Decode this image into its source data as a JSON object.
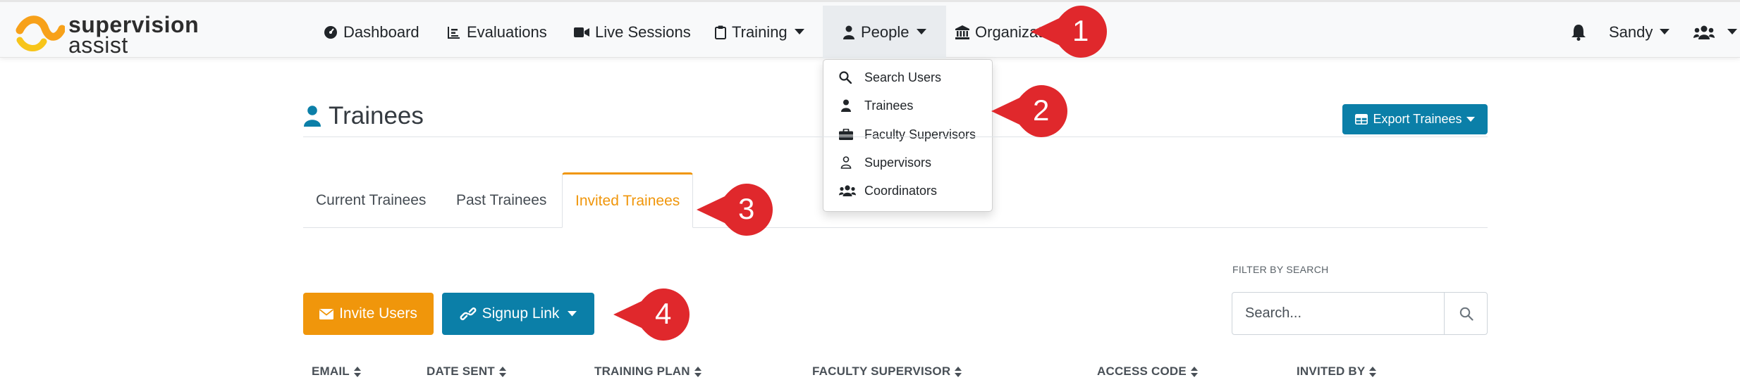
{
  "brand": {
    "line1": "supervision",
    "line2": "assist"
  },
  "nav": {
    "dashboard": "Dashboard",
    "evaluations": "Evaluations",
    "live_sessions": "Live Sessions",
    "training": "Training",
    "people": "People",
    "organization": "Organizat",
    "user_name": "Sandy"
  },
  "people_menu": {
    "items": [
      "Search Users",
      "Trainees",
      "Faculty Supervisors",
      "Supervisors",
      "Coordinators"
    ]
  },
  "page": {
    "title": "Trainees",
    "export_label": "Export Trainees"
  },
  "tabs": [
    "Current Trainees",
    "Past Trainees",
    "Invited Trainees"
  ],
  "actions": {
    "invite_label": "Invite Users",
    "signup_label": "Signup Link"
  },
  "filter": {
    "label": "FILTER BY SEARCH",
    "placeholder": "Search..."
  },
  "table": {
    "columns": [
      "EMAIL",
      "DATE SENT",
      "TRAINING PLAN",
      "FACULTY SUPERVISOR",
      "ACCESS CODE",
      "INVITED BY"
    ]
  },
  "callouts": [
    "1",
    "2",
    "3",
    "4"
  ],
  "colors": {
    "primary": "#0b7fa8",
    "accent": "#f0960b",
    "callout": "#e0282c",
    "logo_orange": "#f7a11a"
  },
  "icons": {
    "dashboard": "tachometer-icon",
    "evaluations": "chart-icon",
    "live_sessions": "video-icon",
    "training": "clipboard-icon",
    "people": "user-icon",
    "organization": "university-icon",
    "notifications": "bell-icon",
    "user_menu": "users-icon"
  }
}
